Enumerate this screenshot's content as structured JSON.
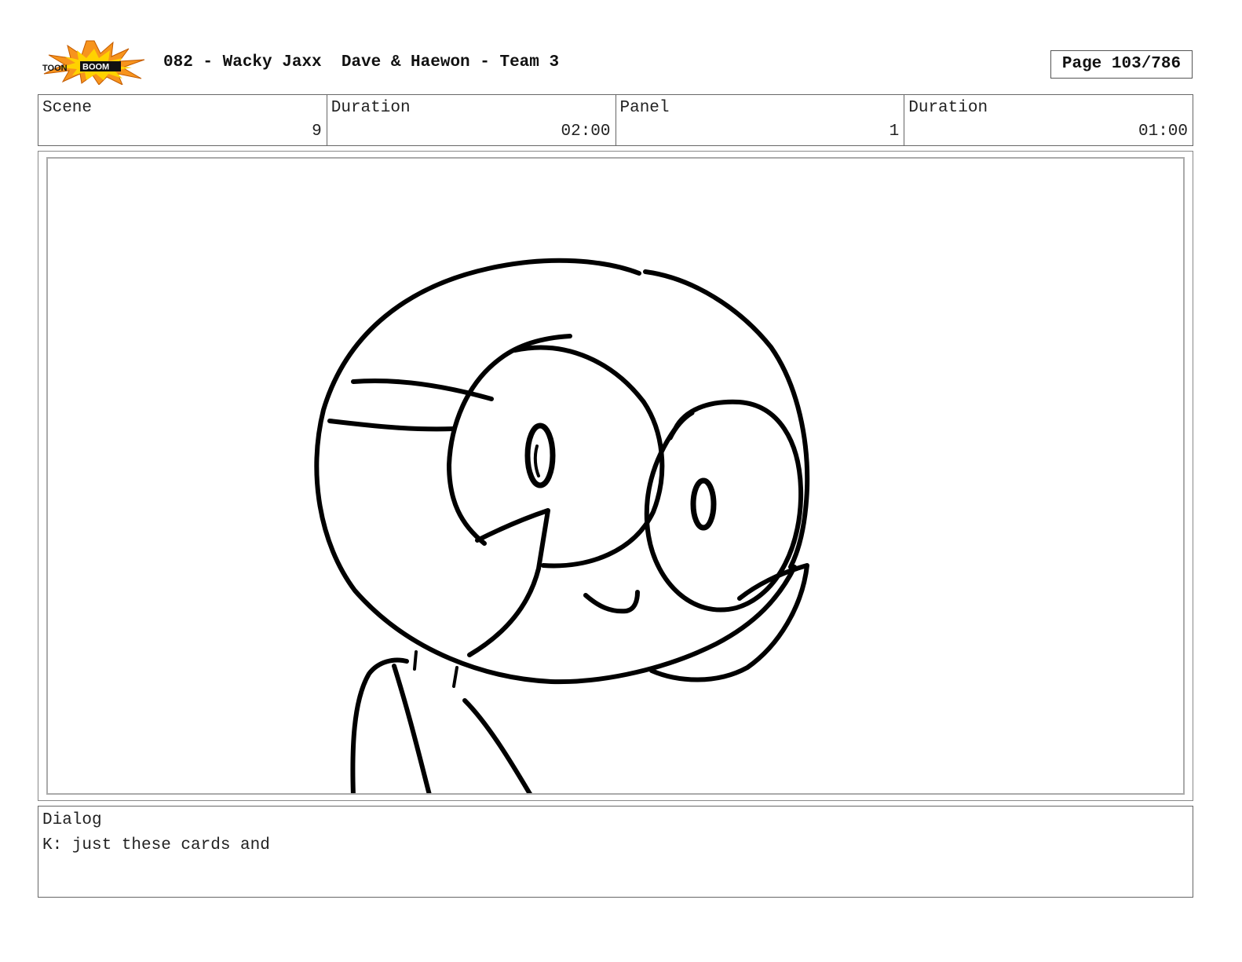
{
  "header": {
    "logo_text_left": "TOON",
    "logo_text_right": "BOOM",
    "title": "082 - Wacky Jaxx  Dave & Haewon - Team 3",
    "page": "Page 103/786"
  },
  "info": {
    "scene_label": "Scene",
    "scene_value": "9",
    "scene_duration_label": "Duration",
    "scene_duration_value": "02:00",
    "panel_label": "Panel",
    "panel_value": "1",
    "panel_duration_label": "Duration",
    "panel_duration_value": "01:00"
  },
  "dialog": {
    "label": "Dialog",
    "text": "K: just these cards and"
  },
  "colors": {
    "logo_orange": "#f7941d",
    "logo_yellow": "#ffd200",
    "ink": "#000000"
  }
}
